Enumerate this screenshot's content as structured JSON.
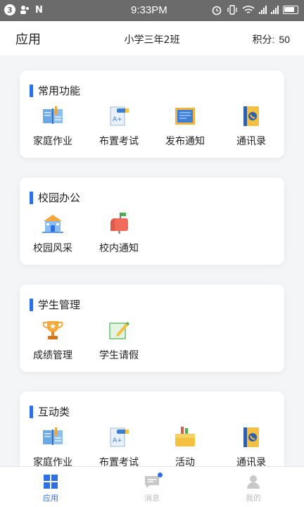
{
  "status_bar": {
    "badge": "3",
    "carrier_glyph": "N",
    "time": "9:33PM",
    "icons": [
      "alarm-icon",
      "vibrate-icon",
      "wifi-icon",
      "signal-icon",
      "signal-icon",
      "battery-icon"
    ]
  },
  "header": {
    "title": "应用",
    "class_name": "小学三年2班",
    "points_label": "积分:",
    "points_value": "50"
  },
  "sections": [
    {
      "title": "常用功能",
      "items": [
        {
          "label": "家庭作业",
          "icon": "homework-book-icon"
        },
        {
          "label": "布置考试",
          "icon": "exam-paper-icon"
        },
        {
          "label": "发布通知",
          "icon": "notice-board-icon"
        },
        {
          "label": "通讯录",
          "icon": "contacts-phone-book-icon"
        }
      ]
    },
    {
      "title": "校园办公",
      "items": [
        {
          "label": "校园风采",
          "icon": "school-building-icon"
        },
        {
          "label": "校内通知",
          "icon": "mailbox-icon"
        }
      ]
    },
    {
      "title": "学生管理",
      "items": [
        {
          "label": "成绩管理",
          "icon": "trophy-icon"
        },
        {
          "label": "学生请假",
          "icon": "leave-note-icon"
        }
      ]
    },
    {
      "title": "互动类",
      "items": [
        {
          "label": "家庭作业",
          "icon": "homework-book-icon"
        },
        {
          "label": "布置考试",
          "icon": "exam-paper-icon"
        },
        {
          "label": "活动",
          "icon": "activity-folder-icon"
        },
        {
          "label": "通讯录",
          "icon": "contacts-phone-book-icon"
        }
      ]
    }
  ],
  "bottom_nav": [
    {
      "label": "应用",
      "icon": "apps-grid-icon",
      "active": true
    },
    {
      "label": "消息",
      "icon": "message-bubble-icon",
      "active": false,
      "badge_dot": true
    },
    {
      "label": "我的",
      "icon": "profile-person-icon",
      "active": false
    }
  ],
  "colors": {
    "accent": "#2f6fe6",
    "background": "#f4f5f7",
    "inactive_tab": "#bbbbbb"
  }
}
